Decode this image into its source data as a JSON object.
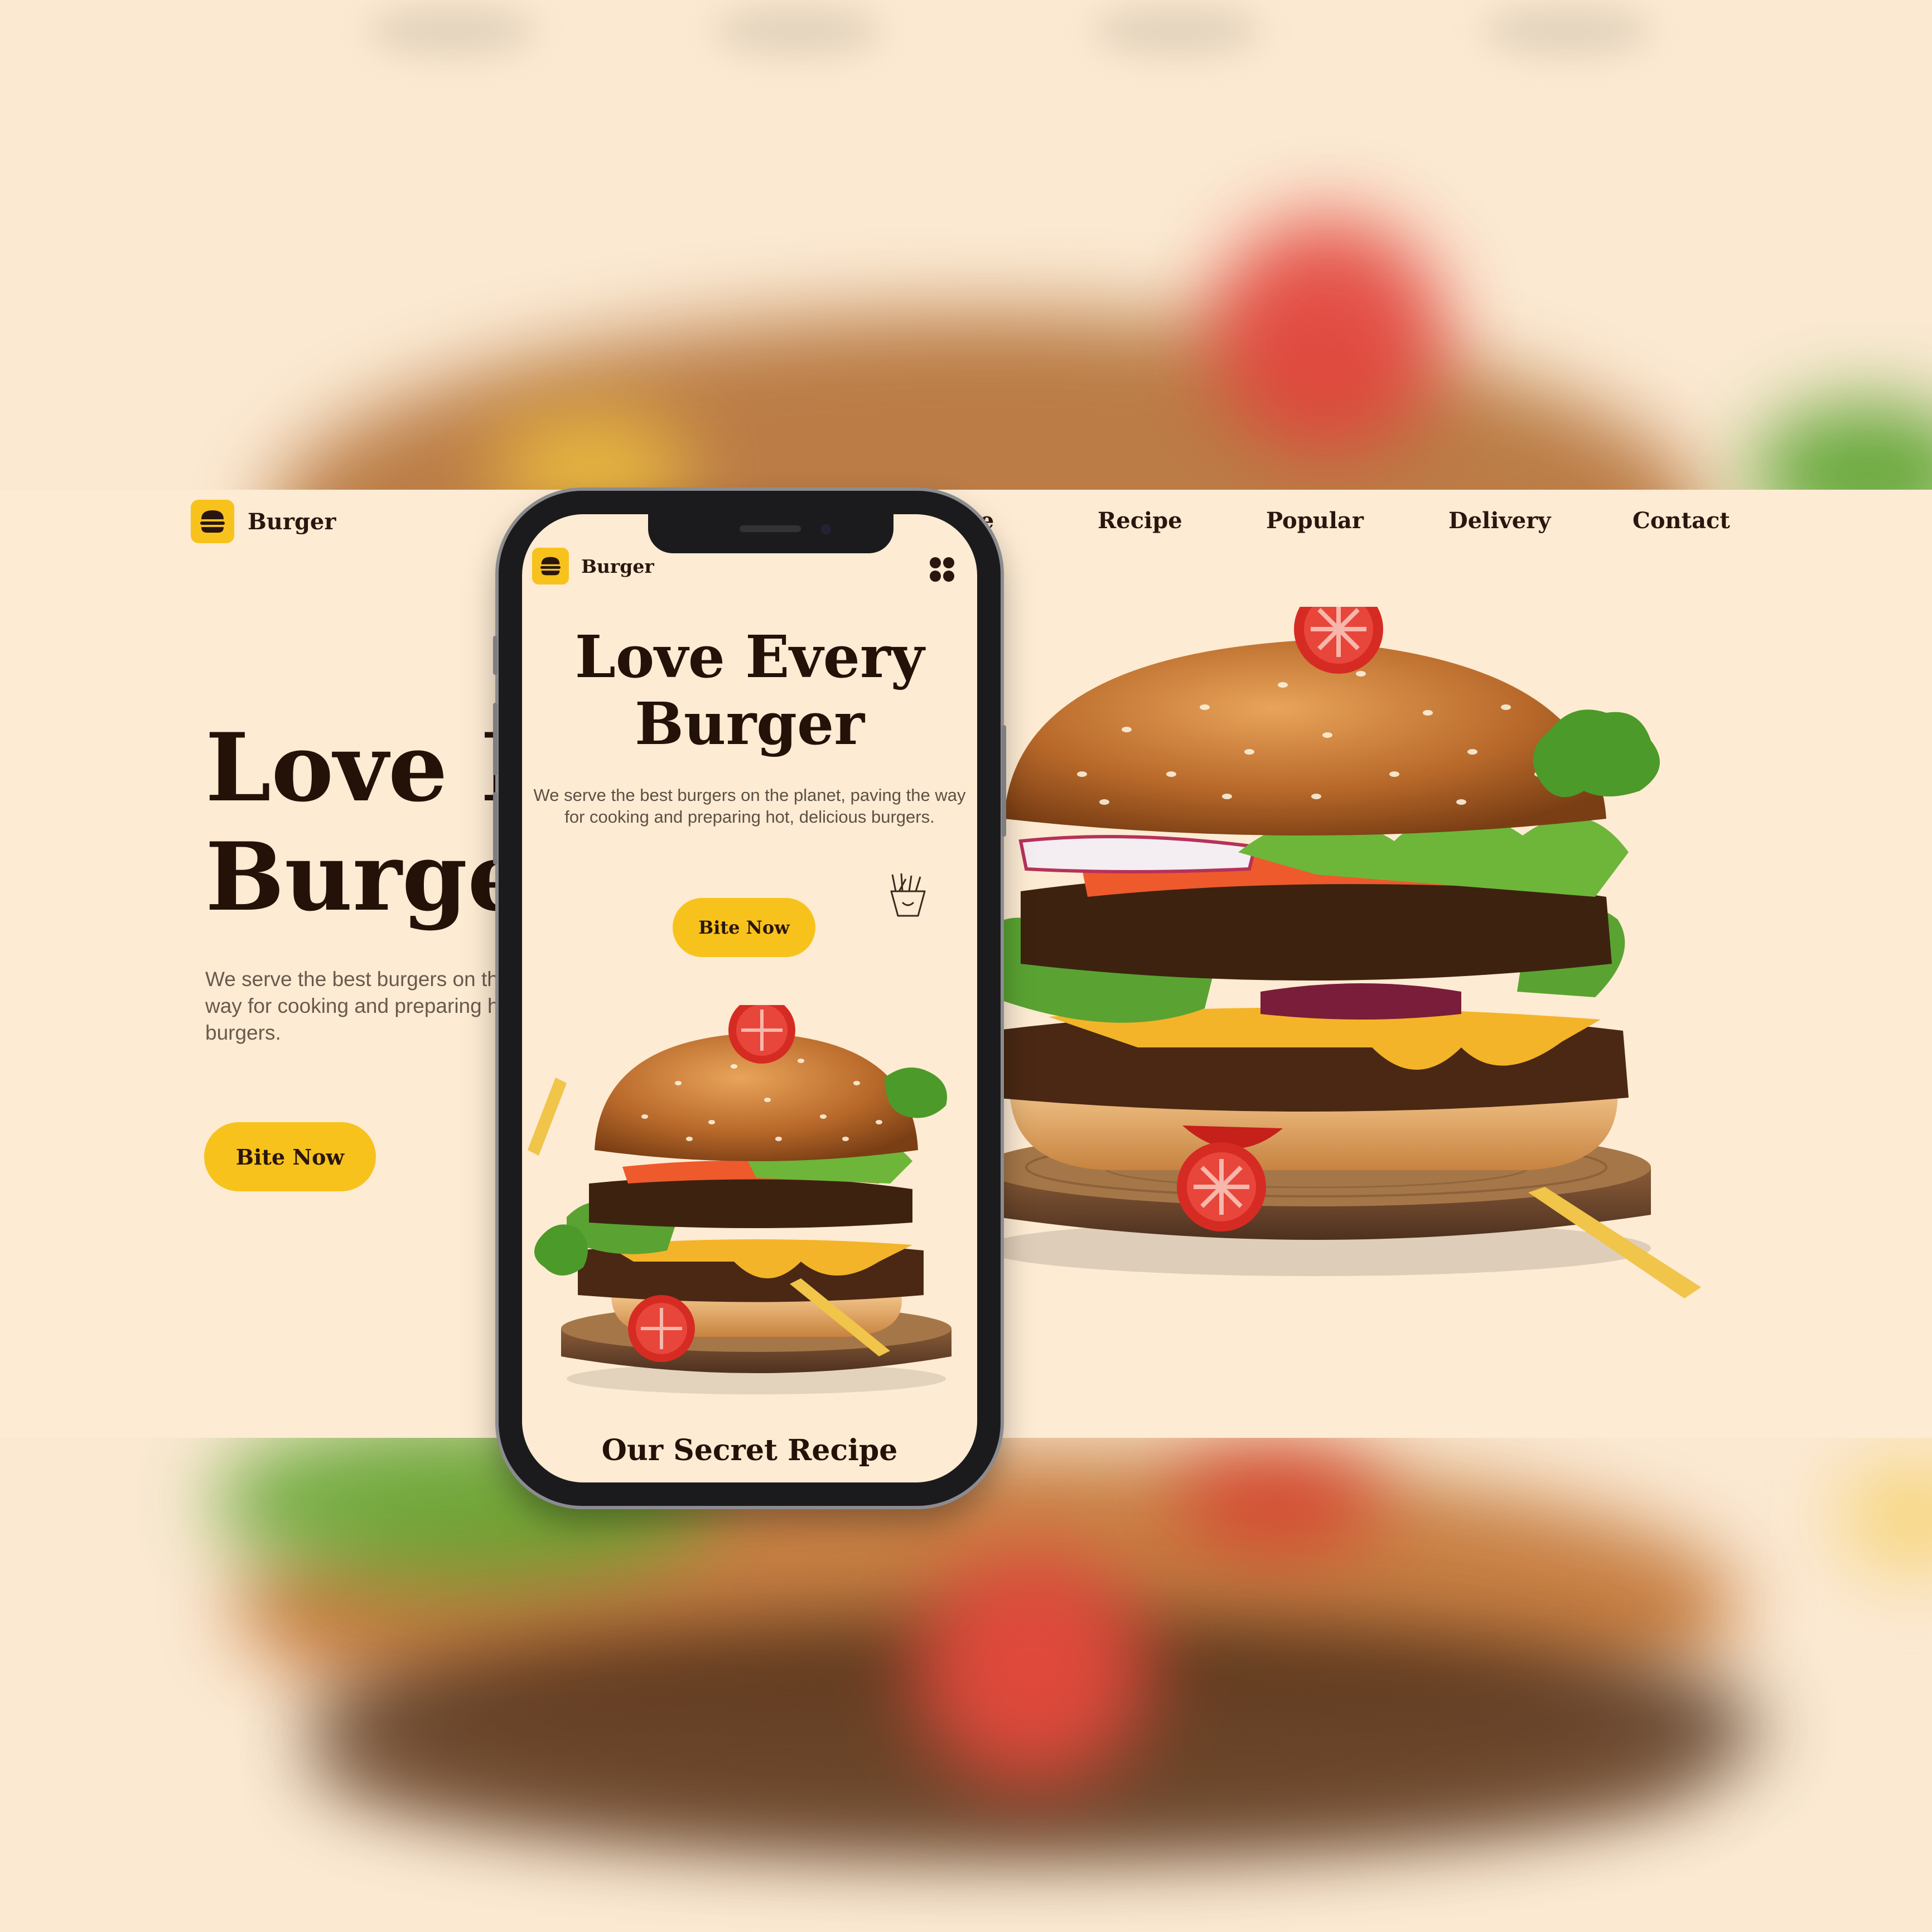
{
  "desktop": {
    "brand": "Burger",
    "nav": [
      "Home",
      "Recipe",
      "Popular",
      "Delivery",
      "Contact"
    ],
    "hero_title": "Love Every\nBurger",
    "hero_text": "We serve the best burgers on the planet, paving the way for cooking and preparing hot, delicious burgers.",
    "cta_label": "Bite Now"
  },
  "mobile": {
    "brand": "Burger",
    "menu_icon": "grid-menu-icon",
    "hero_title": "Love Every\nBurger",
    "hero_text": "We serve the best burgers on the planet, paving the way for cooking and preparing hot, delicious burgers.",
    "cta_label": "Bite Now",
    "decor_icon": "fries-icon",
    "section_title": "Our Secret Recipe"
  },
  "colors": {
    "background": "#fdebd3",
    "accent": "#f7c21c",
    "text_dark": "#241208",
    "text_muted": "#6a5a4d"
  }
}
